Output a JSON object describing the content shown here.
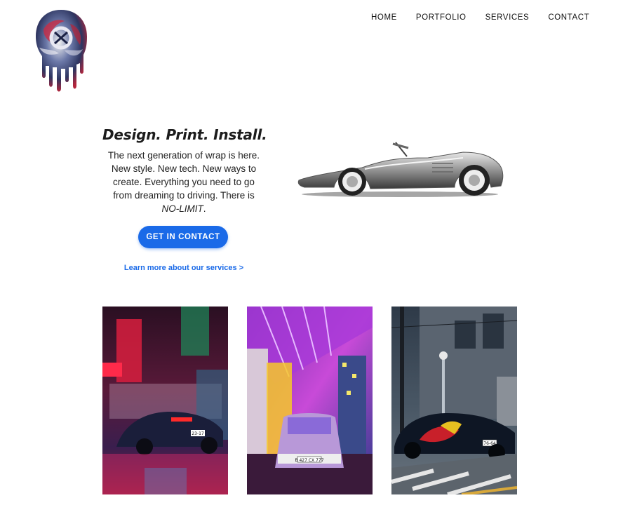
{
  "nav": {
    "items": [
      {
        "label": "HOME"
      },
      {
        "label": "PORTFOLIO"
      },
      {
        "label": "SERVICES"
      },
      {
        "label": "CONTACT"
      }
    ]
  },
  "hero": {
    "title": "Design. Print. Install.",
    "body": "The next generation of wrap is here. New style. New tech. New ways to create. Everything you need to go from dreaming to driving. There is",
    "body_emphasis": "NO-LIMIT",
    "body_end": ".",
    "cta_label": "GET IN CONTACT",
    "learn_more_label": "Learn more about our services >"
  },
  "gallery": {
    "plates": [
      "В 427 СХ 777",
      "76-64",
      "23-17"
    ]
  },
  "colors": {
    "accent": "#1a6ae8",
    "text": "#222222",
    "background": "#ffffff"
  },
  "icons": {
    "logo": "dripping-skull-logo"
  }
}
